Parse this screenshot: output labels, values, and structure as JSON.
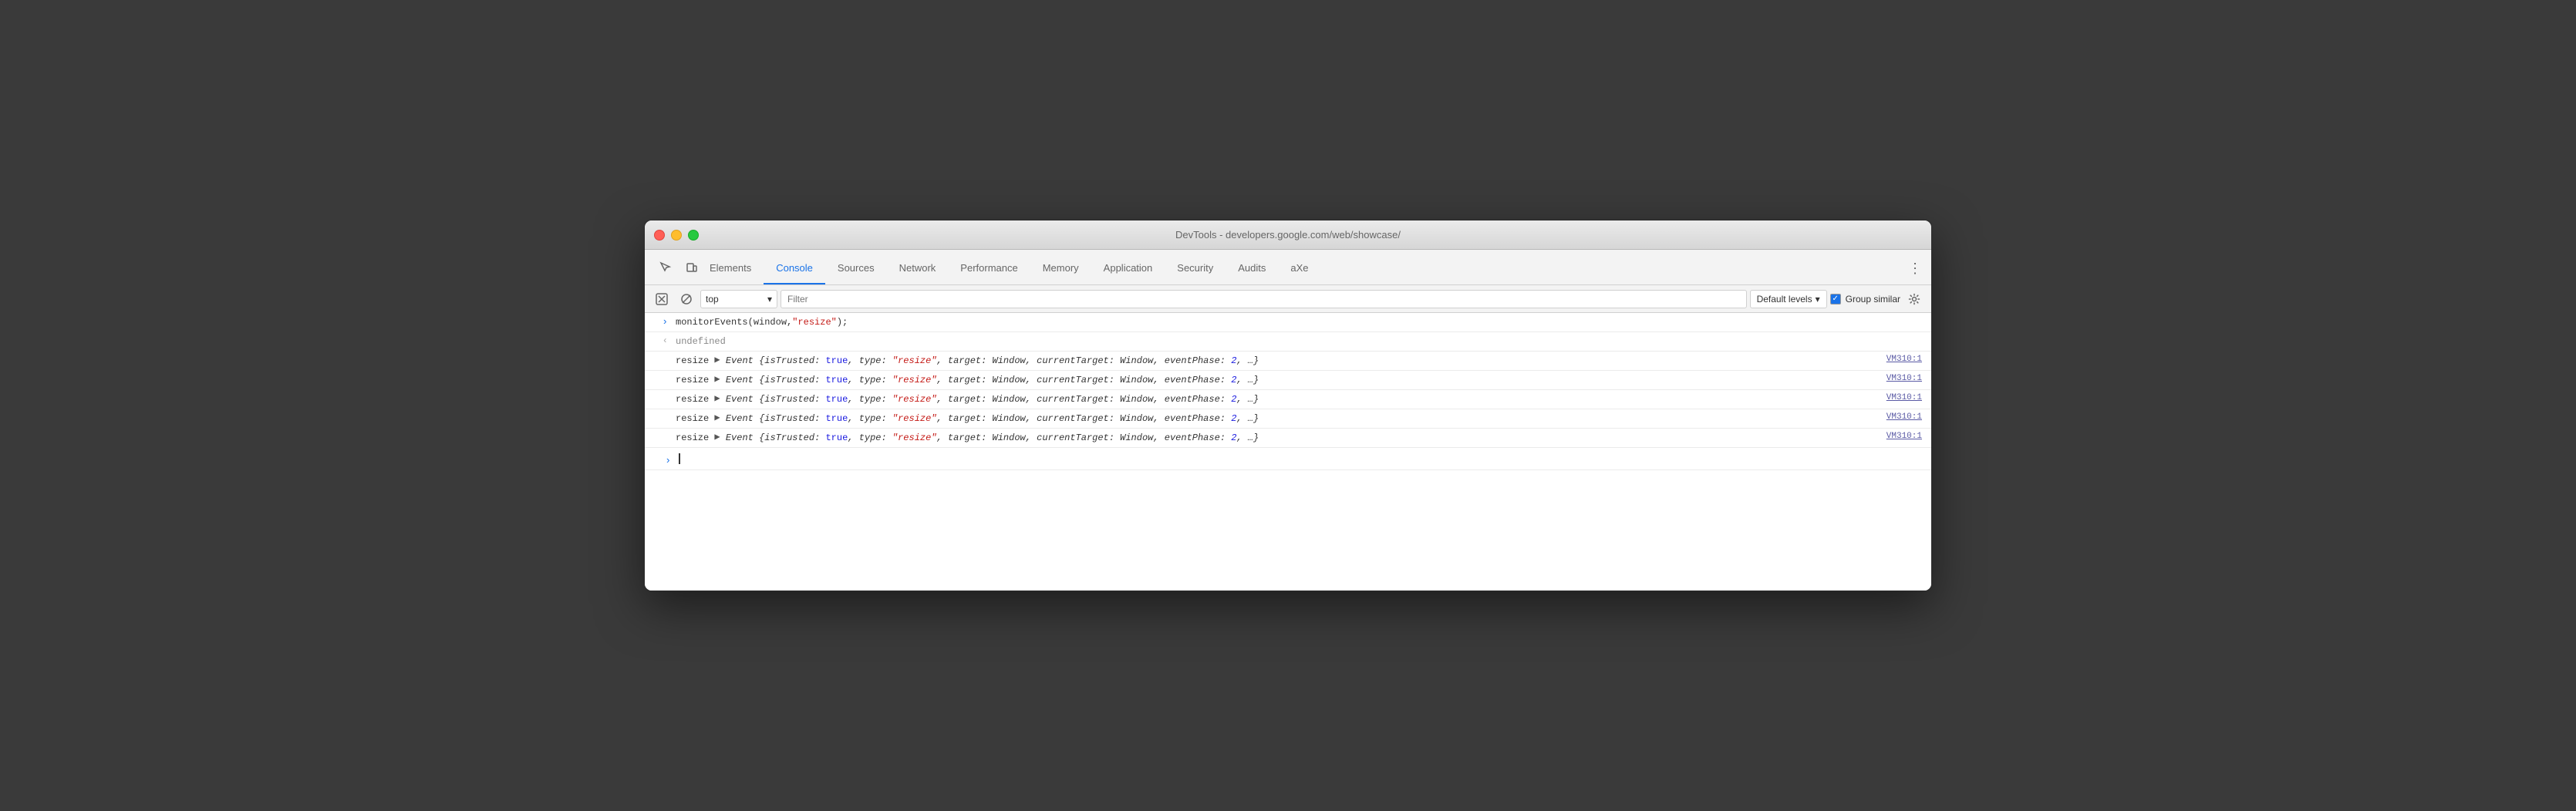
{
  "titlebar": {
    "title": "DevTools - developers.google.com/web/showcase/"
  },
  "tabs": [
    {
      "id": "elements",
      "label": "Elements",
      "active": false
    },
    {
      "id": "console",
      "label": "Console",
      "active": true
    },
    {
      "id": "sources",
      "label": "Sources",
      "active": false
    },
    {
      "id": "network",
      "label": "Network",
      "active": false
    },
    {
      "id": "performance",
      "label": "Performance",
      "active": false
    },
    {
      "id": "memory",
      "label": "Memory",
      "active": false
    },
    {
      "id": "application",
      "label": "Application",
      "active": false
    },
    {
      "id": "security",
      "label": "Security",
      "active": false
    },
    {
      "id": "audits",
      "label": "Audits",
      "active": false
    },
    {
      "id": "axe",
      "label": "aXe",
      "active": false
    }
  ],
  "toolbar": {
    "context_value": "top",
    "filter_placeholder": "Filter",
    "levels_label": "Default levels",
    "group_similar_label": "Group similar",
    "group_similar_checked": true
  },
  "console_entries": [
    {
      "type": "input",
      "content": "monitorEvents(window, \"resize\");"
    },
    {
      "type": "output",
      "content": "undefined"
    },
    {
      "type": "event",
      "prefix": "resize",
      "content": "Event {isTrusted: true, type: \"resize\", target: Window, currentTarget: Window, eventPhase: 2, …}",
      "link": "VM310:1"
    },
    {
      "type": "event",
      "prefix": "resize",
      "content": "Event {isTrusted: true, type: \"resize\", target: Window, currentTarget: Window, eventPhase: 2, …}",
      "link": "VM310:1"
    },
    {
      "type": "event",
      "prefix": "resize",
      "content": "Event {isTrusted: true, type: \"resize\", target: Window, currentTarget: Window, eventPhase: 2, …}",
      "link": "VM310:1"
    },
    {
      "type": "event",
      "prefix": "resize",
      "content": "Event {isTrusted: true, type: \"resize\", target: Window, currentTarget: Window, eventPhase: 2, …}",
      "link": "VM310:1"
    },
    {
      "type": "event",
      "prefix": "resize",
      "content": "Event {isTrusted: true, type: \"resize\", target: Window, currentTarget: Window, eventPhase: 2, …}",
      "link": "VM310:1"
    }
  ],
  "colors": {
    "active_tab": "#1a73e8",
    "code_blue": "#1a1ae0",
    "code_red": "#c41a16"
  }
}
